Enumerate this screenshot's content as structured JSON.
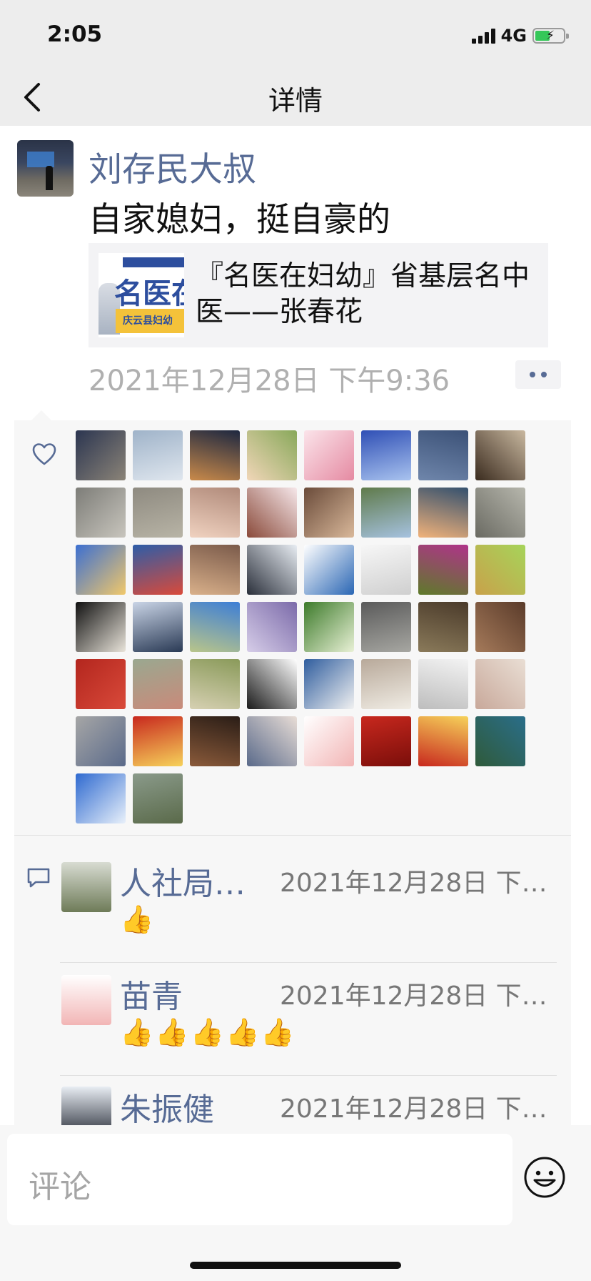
{
  "status_bar": {
    "time": "2:05",
    "network": "4G"
  },
  "nav": {
    "title": "详情"
  },
  "post": {
    "author": "刘存民大叔",
    "text": "自家媳妇，挺自豪的",
    "link": {
      "thumb_text": "名医在",
      "thumb_sub": "庆云县妇幼",
      "title": "『名医在妇幼』省基层名中医——张春花"
    },
    "time": "2021年12月28日 下午9:36"
  },
  "likes": {
    "icon": "heart-icon",
    "avatars": [
      {
        "c1": "#2b3550",
        "c2": "#8b8478"
      },
      {
        "c1": "#9fb3c9",
        "c2": "#dfe6ee"
      },
      {
        "c1": "#1d2740",
        "c2": "#c98a4a"
      },
      {
        "c1": "#88a85a",
        "c2": "#f1d6b8"
      },
      {
        "c1": "#fbe4ea",
        "c2": "#e58aa2"
      },
      {
        "c1": "#2f4fb5",
        "c2": "#a9c3ef"
      },
      {
        "c1": "#3b5177",
        "c2": "#6f86ab"
      },
      {
        "c1": "#c9b8a0",
        "c2": "#3a2b1e"
      },
      {
        "c1": "#7d7d78",
        "c2": "#c8c5bd"
      },
      {
        "c1": "#8e8a80",
        "c2": "#b8b4a6"
      },
      {
        "c1": "#b08a7a",
        "c2": "#f0d2c0"
      },
      {
        "c1": "#f6e7ea",
        "c2": "#8a4a3a"
      },
      {
        "c1": "#6a4b3a",
        "c2": "#d9b89a"
      },
      {
        "c1": "#5f7a4a",
        "c2": "#a6c2e0"
      },
      {
        "c1": "#33506e",
        "c2": "#f1b27a"
      },
      {
        "c1": "#b7b7ad",
        "c2": "#6a6a62"
      },
      {
        "c1": "#3c6fd1",
        "c2": "#f1c86a"
      },
      {
        "c1": "#2d5da8",
        "c2": "#d94a3a"
      },
      {
        "c1": "#7a5a4a",
        "c2": "#d9b08a"
      },
      {
        "c1": "#e8edf3",
        "c2": "#2a2f3a"
      },
      {
        "c1": "#ffffff",
        "c2": "#2a66b4"
      },
      {
        "c1": "#f7f7f7",
        "c2": "#cfcfcf"
      },
      {
        "c1": "#b0338a",
        "c2": "#5e7a2a"
      },
      {
        "c1": "#a6d45a",
        "c2": "#c9a14a"
      },
      {
        "c1": "#111111",
        "c2": "#e9e4da"
      },
      {
        "c1": "#c9d4e6",
        "c2": "#2a3a55"
      },
      {
        "c1": "#3d7ed6",
        "c2": "#b9c58a"
      },
      {
        "c1": "#7b6aa9",
        "c2": "#d6cde8"
      },
      {
        "c1": "#3c7a2a",
        "c2": "#e9f1d6"
      },
      {
        "c1": "#5a5a5a",
        "c2": "#a7a7a2"
      },
      {
        "c1": "#4a3a2a",
        "c2": "#8a7a5a"
      },
      {
        "c1": "#5a3b2a",
        "c2": "#a57a5a"
      },
      {
        "c1": "#b3261e",
        "c2": "#d94a3a"
      },
      {
        "c1": "#9aa890",
        "c2": "#c98a7a"
      },
      {
        "c1": "#8a9a5a",
        "c2": "#d6d0b2"
      },
      {
        "c1": "#ffffff",
        "c2": "#1a1a1a"
      },
      {
        "c1": "#2f5d9e",
        "c2": "#f1f1f1"
      },
      {
        "c1": "#b8a99a",
        "c2": "#f0ece4"
      },
      {
        "c1": "#f3f3f3",
        "c2": "#bdbdbd"
      },
      {
        "c1": "#e9ded4",
        "c2": "#c8a89a"
      },
      {
        "c1": "#a6a6a6",
        "c2": "#5a6a8a"
      },
      {
        "c1": "#c8281e",
        "c2": "#f6d25a"
      },
      {
        "c1": "#2a1d16",
        "c2": "#8a5a3a"
      },
      {
        "c1": "#e8ddd6",
        "c2": "#5a6a8a"
      },
      {
        "c1": "#ffffff",
        "c2": "#f2b5b5"
      },
      {
        "c1": "#c8281e",
        "c2": "#7a0e0a"
      },
      {
        "c1": "#f6d25a",
        "c2": "#c8281e"
      },
      {
        "c1": "#2a6e8a",
        "c2": "#2f5a3a"
      },
      {
        "c1": "#2f6ad0",
        "c2": "#e8f0fa"
      },
      {
        "c1": "#8a9a8a",
        "c2": "#5a6a4a"
      }
    ]
  },
  "comments": [
    {
      "name": "人社局…",
      "time": "2021年12月28日 下…",
      "body": "👍",
      "avatar": {
        "c1": "#d8dcd2",
        "c2": "#6e7b58"
      }
    },
    {
      "name": "苗青",
      "time": "2021年12月28日 下…",
      "body": "👍👍👍👍👍",
      "avatar": {
        "c1": "#ffffff",
        "c2": "#f2b5b5"
      }
    },
    {
      "name": "朱振健",
      "time": "2021年12月28日 下…",
      "body": "",
      "avatar": {
        "c1": "#e8edf3",
        "c2": "#2a2f3a"
      }
    }
  ],
  "input": {
    "placeholder": "评论",
    "emoji_icon": "emoji-icon"
  },
  "colors": {
    "accent": "#576b95",
    "panel_bg": "#f7f7f7",
    "nav_bg": "#ededed"
  }
}
